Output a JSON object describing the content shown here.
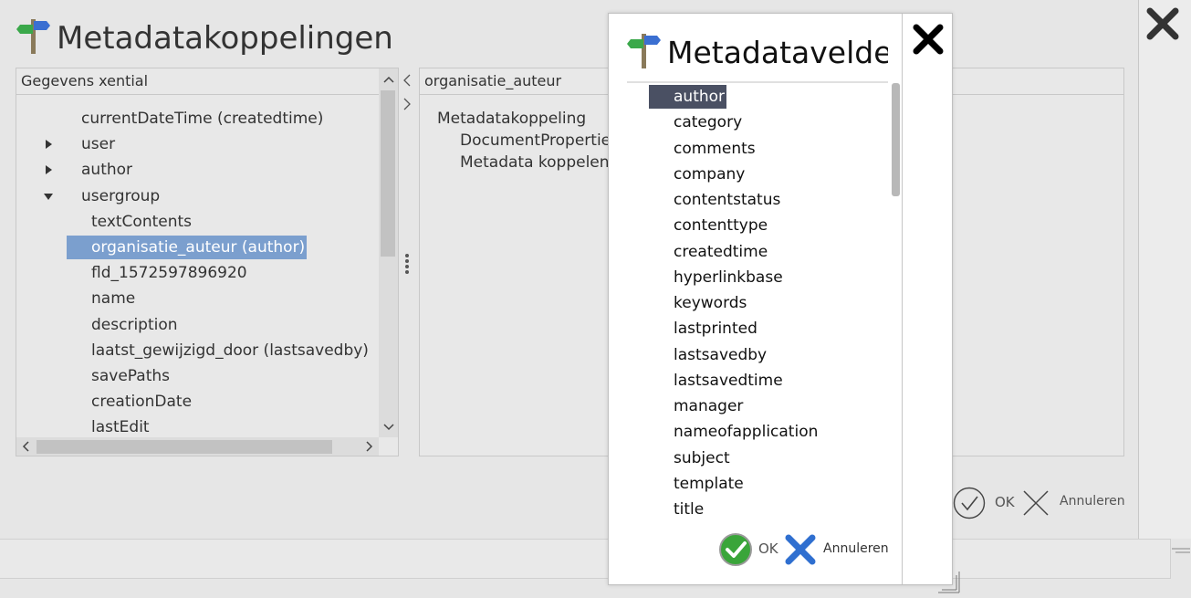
{
  "main": {
    "title": "Metadatakoppelingen",
    "left_panel": {
      "header": "Gegevens xential",
      "items": [
        {
          "label": "currentDateTime (createdtime)",
          "expander": "none",
          "indent": 0
        },
        {
          "label": "user",
          "expander": "collapsed",
          "indent": 0
        },
        {
          "label": "author",
          "expander": "collapsed",
          "indent": 0
        },
        {
          "label": "usergroup",
          "expander": "expanded",
          "indent": 0
        },
        {
          "label": "textContents",
          "expander": "none",
          "indent": 1
        },
        {
          "label": "organisatie_auteur (author)",
          "expander": "none",
          "indent": 1,
          "selected": true
        },
        {
          "label": "fld_1572597896920",
          "expander": "none",
          "indent": 1
        },
        {
          "label": "name",
          "expander": "none",
          "indent": 1
        },
        {
          "label": "description",
          "expander": "none",
          "indent": 1
        },
        {
          "label": "laatst_gewijzigd_door (lastsavedby)",
          "expander": "none",
          "indent": 1
        },
        {
          "label": "savePaths",
          "expander": "none",
          "indent": 1
        },
        {
          "label": "creationDate",
          "expander": "none",
          "indent": 1
        },
        {
          "label": "lastEdit",
          "expander": "none",
          "indent": 1
        }
      ]
    },
    "right_panel": {
      "header": "organisatie_auteur",
      "items": [
        {
          "label": "Metadatakoppeling",
          "indent": 0
        },
        {
          "label": "DocumentProperties",
          "indent": 1
        },
        {
          "label": "Metadata koppelen",
          "indent": 1
        }
      ]
    },
    "ok_label": "OK",
    "cancel_label": "Annuleren"
  },
  "dialog": {
    "title": "Metadatavelden",
    "fields": [
      "author",
      "category",
      "comments",
      "company",
      "contentstatus",
      "contenttype",
      "createdtime",
      "hyperlinkbase",
      "keywords",
      "lastprinted",
      "lastsavedby",
      "lastsavedtime",
      "manager",
      "nameofapplication",
      "subject",
      "template",
      "title"
    ],
    "selected_index": 0,
    "ok_label": "OK",
    "cancel_label": "Annuleren"
  },
  "colors": {
    "selection": "#7b9fce",
    "dialog_selection": "#4a5063",
    "ok_green": "#3aa53a",
    "cancel_blue": "#2f6fd0"
  }
}
